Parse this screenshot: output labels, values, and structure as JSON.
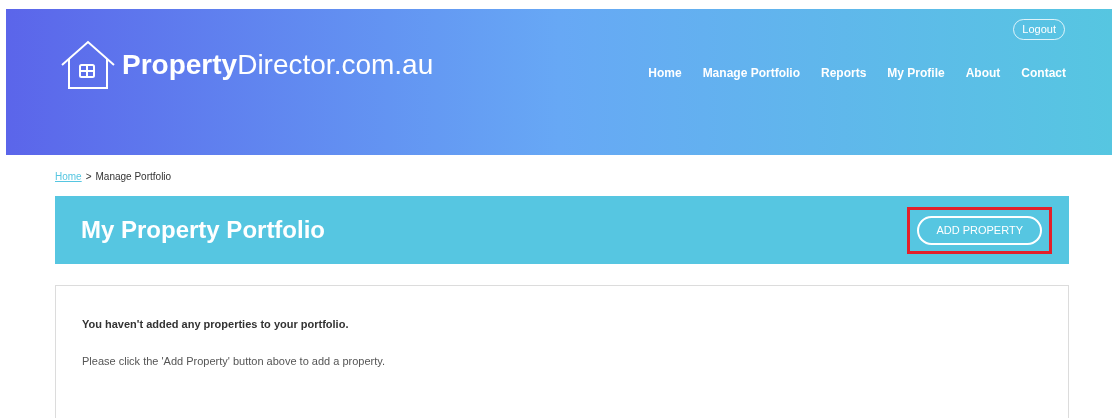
{
  "header": {
    "logo": {
      "strong": "Property",
      "light": "Director.com.au"
    },
    "logout": "Logout",
    "nav": [
      {
        "label": "Home"
      },
      {
        "label": "Manage Portfolio"
      },
      {
        "label": "Reports"
      },
      {
        "label": "My Profile"
      },
      {
        "label": "About"
      },
      {
        "label": "Contact"
      }
    ]
  },
  "breadcrumb": {
    "link": "Home",
    "separator": ">",
    "current": "Manage Portfolio"
  },
  "banner": {
    "title": "My Property Portfolio",
    "button": {
      "label": "ADD PROPERTY",
      "highlighted": true
    }
  },
  "content": {
    "heading": "You haven't added any properties to your portfolio.",
    "message": "Please click the 'Add Property' button above to add a property."
  }
}
